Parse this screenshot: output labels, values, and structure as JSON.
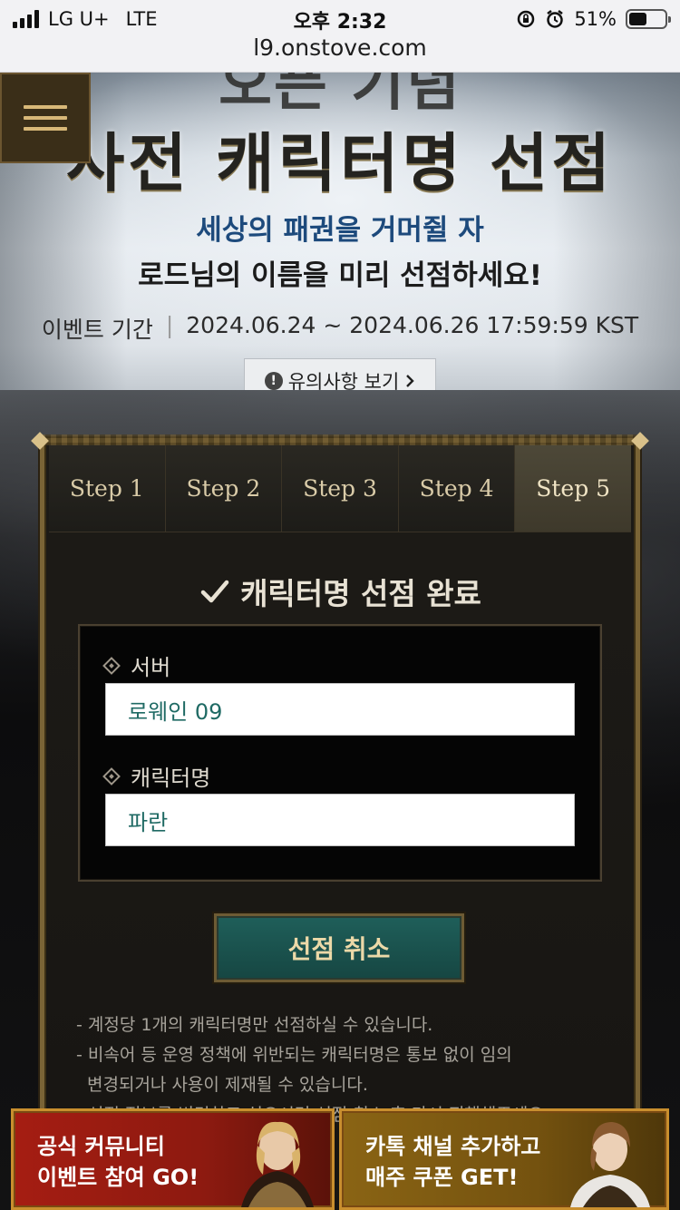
{
  "status_bar": {
    "carrier": "LG U+",
    "network": "LTE",
    "time": "오후 2:32",
    "battery": "51%",
    "battery_level": 0.51,
    "url": "l9.onstove.com"
  },
  "hero": {
    "title_top": "오픈 기념",
    "title": "사전 캐릭터명 선점",
    "subtitle1": "세상의 패권을 거머쥘 자",
    "subtitle2": "로드님의 이름을 미리 선점하세요!",
    "period_label": "이벤트 기간",
    "period_value": "2024.06.24 ~ 2024.06.26 17:59:59 KST",
    "notice_button": "유의사항 보기"
  },
  "steps": {
    "tabs": [
      "Step 1",
      "Step 2",
      "Step 3",
      "Step 4",
      "Step 5"
    ],
    "active_index": 4
  },
  "result": {
    "title": "캐릭터명 선점 완료",
    "server_label": "서버",
    "server_value": "로웨인 09",
    "character_label": "캐릭터명",
    "character_value": "파란",
    "cancel_button": "선점 취소"
  },
  "notes": [
    "- 계정당 1개의 캐릭터명만 선점하실 수 있습니다.",
    "- 비속어 등 운영 정책에 위반되는 캐릭터명은 통보 없이 임의",
    "  변경되거나 사용이 제재될 수 있습니다.",
    "- 선점 정보를 변경하고 싶으시면 선점 취소 후 다시 진행해주세요."
  ],
  "banners": {
    "left_line1": "공식 커뮤니티",
    "left_line2": "이벤트 참여 GO!",
    "right_line1": "카톡 채널 추가하고",
    "right_line2": "매주 쿠폰 GET!"
  },
  "colors": {
    "accent_gold": "#d9cba8",
    "subtitle_blue": "#1d4a7c",
    "input_text": "#1f6a64",
    "cancel_button_bg": "#1f5f5a",
    "banner_left_bg": "#a51d12",
    "banner_right_bg": "#8a6414"
  },
  "icons": {
    "menu": "hamburger-menu-icon",
    "notice": "info-circle-icon",
    "notice_arrow": "chevron-right-icon",
    "complete": "check-icon",
    "field_marker": "diamond-icon"
  }
}
